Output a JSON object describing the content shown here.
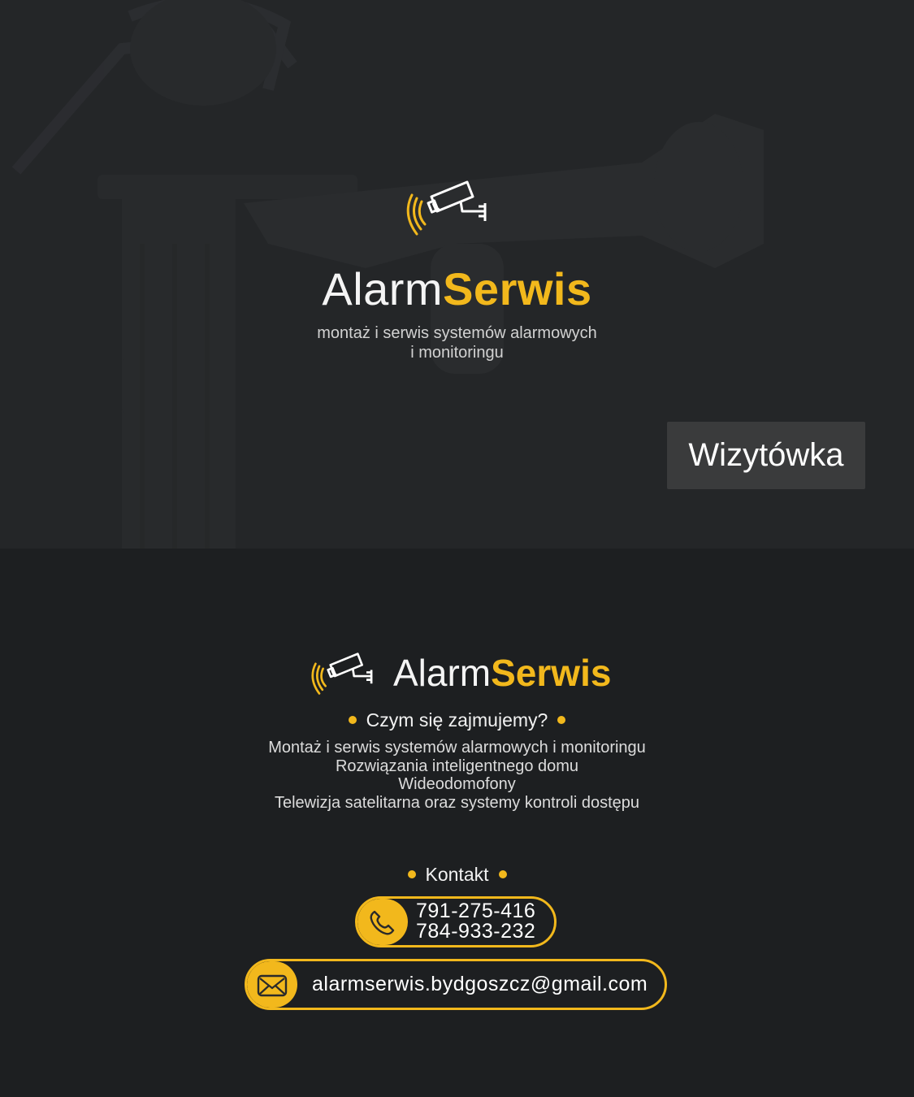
{
  "brand": {
    "name_light": "Alarm",
    "name_bold": "Serwis"
  },
  "hero": {
    "tagline_line1": "montaż i serwis systemów alarmowych",
    "tagline_line2": "i monitoringu",
    "vcard_button": "Wizytówka"
  },
  "services": {
    "heading": "Czym się zajmujemy?",
    "items": [
      "Montaż i serwis systemów alarmowych i monitoringu",
      "Rozwiązania inteligentnego domu",
      "Wideodomofony",
      "Telewizja satelitarna oraz systemy kontroli dostępu"
    ]
  },
  "contact": {
    "heading": "Kontakt",
    "phone1": "791-275-416",
    "phone2": "784-933-232",
    "email": "alarmserwis.bydgoszcz@gmail.com"
  },
  "colors": {
    "accent": "#f2b81c",
    "background": "#1d1f21",
    "hero_background": "#242628",
    "button_background": "#3a3b3c"
  },
  "icons": {
    "logo": "security-camera-icon",
    "phone": "phone-icon",
    "email": "envelope-icon"
  }
}
